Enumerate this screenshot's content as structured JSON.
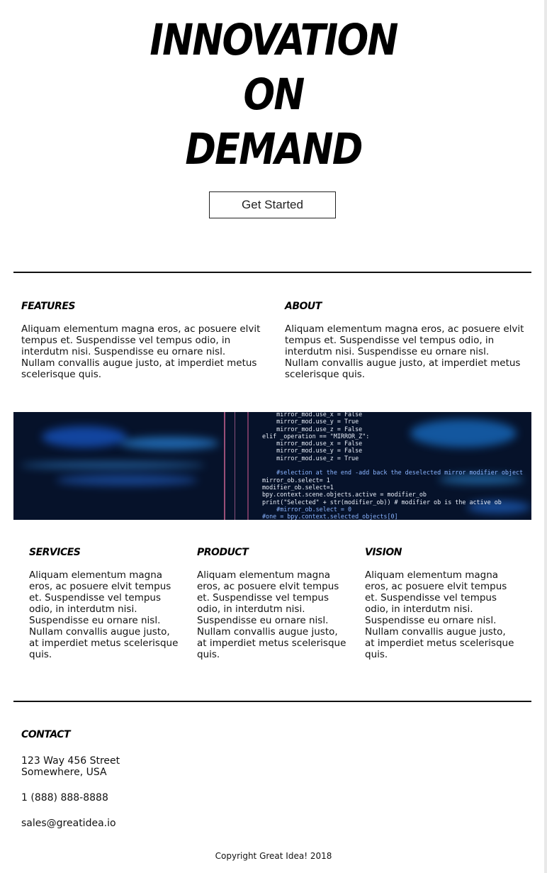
{
  "hero": {
    "title_lines": [
      "INNOVATION",
      "ON",
      "DEMAND"
    ],
    "cta_label": "Get Started"
  },
  "features": {
    "heading": "FEATURES",
    "text": "Aliquam elementum magna eros, ac posuere elvit tempus et. Suspendisse vel tempus odio, in interdutm nisi. Suspendisse eu ornare nisl. Nullam convallis augue justo, at imperdiet metus scelerisque quis."
  },
  "about": {
    "heading": "ABOUT",
    "text": "Aliquam elementum magna eros, ac posuere elvit tempus et. Suspendisse vel tempus odio, in interdutm nisi. Suspendisse eu ornare nisl. Nullam convallis augue justo, at imperdiet metus scelerisque quis."
  },
  "banner": {
    "code_lines": [
      "    mirror_mod.use_x = False",
      "    mirror_mod.use_y = True",
      "    mirror_mod.use_z = False",
      "elif _operation == \"MIRROR_Z\":",
      "    mirror_mod.use_x = False",
      "    mirror_mod.use_y = False",
      "    mirror_mod.use_z = True",
      "",
      "    #selection at the end -add back the deselected mirror modifier object",
      "mirror_ob.select= 1",
      "modifier_ob.select=1",
      "bpy.context.scene.objects.active = modifier_ob",
      "print(\"Selected\" + str(modifier_ob)) # modifier ob is the active ob",
      "    #mirror_ob.select = 0",
      "#one = bpy.context.selected_objects[0]"
    ]
  },
  "services": {
    "heading": "SERVICES",
    "text": "Aliquam elementum magna eros, ac posuere elvit tempus et. Suspendisse vel tempus odio, in interdutm nisi. Suspendisse eu ornare nisl. Nullam convallis augue justo, at imperdiet metus scelerisque quis."
  },
  "product": {
    "heading": "PRODUCT",
    "text": "Aliquam elementum magna eros, ac posuere elvit tempus et. Suspendisse vel tempus odio, in interdutm nisi. Suspendisse eu ornare nisl. Nullam convallis augue justo, at imperdiet metus scelerisque quis."
  },
  "vision": {
    "heading": "VISION",
    "text": "Aliquam elementum magna eros, ac posuere elvit tempus et. Suspendisse vel tempus odio, in interdutm nisi. Suspendisse eu ornare nisl. Nullam convallis augue justo, at imperdiet metus scelerisque quis."
  },
  "contact": {
    "heading": "CONTACT",
    "address_line1": "123 Way 456 Street",
    "address_line2": "Somewhere, USA",
    "phone": "1 (888) 888-8888",
    "email": "sales@greatidea.io"
  },
  "footer": {
    "copyright": "Copyright Great Idea! 2018"
  }
}
